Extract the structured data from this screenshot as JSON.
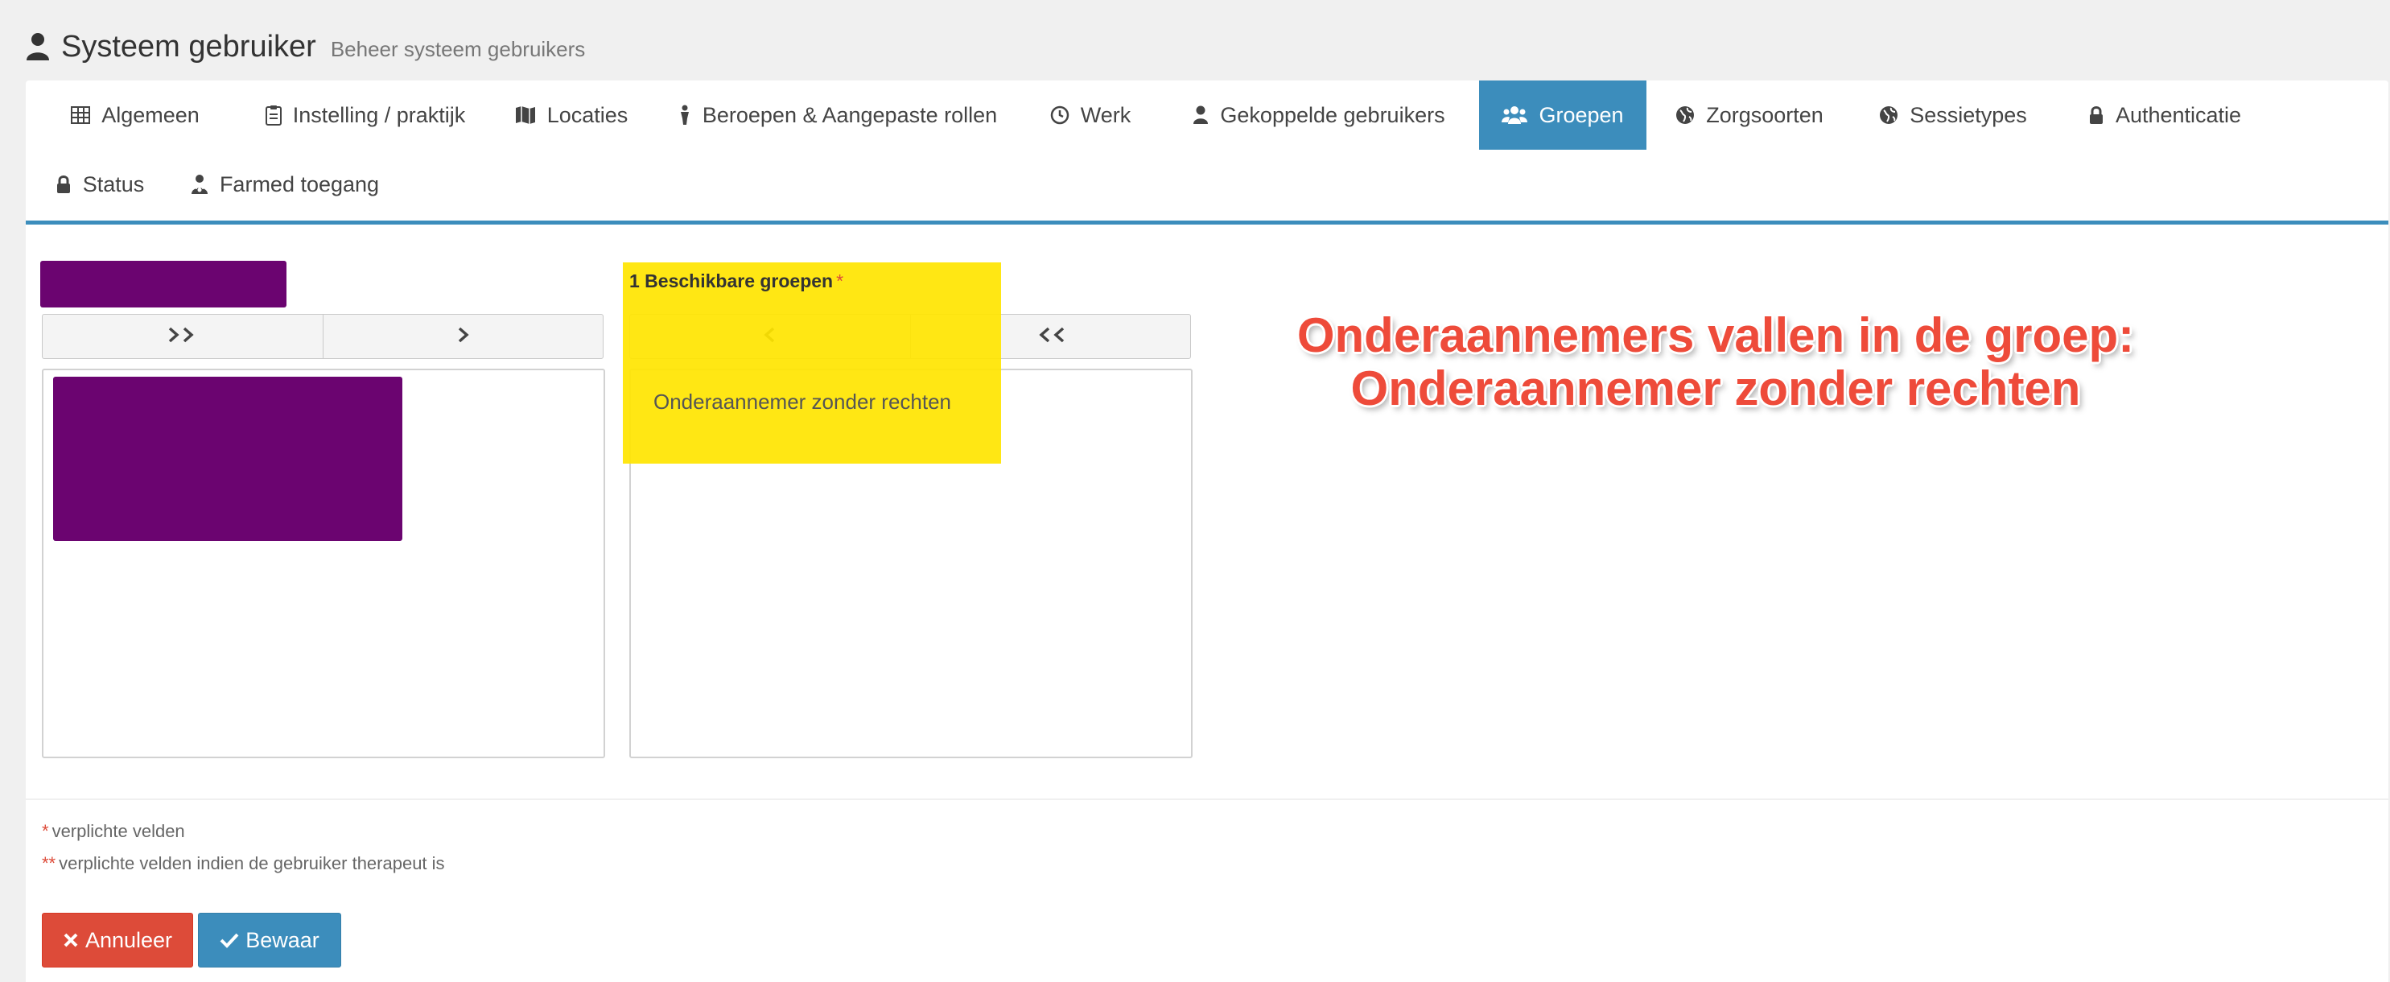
{
  "header": {
    "title": "Systeem gebruiker",
    "subtitle": "Beheer systeem gebruikers",
    "icon": "user-icon"
  },
  "tabs": [
    {
      "label": "Algemeen",
      "icon": "table-icon"
    },
    {
      "label": "Instelling / praktijk",
      "icon": "clipboard-icon"
    },
    {
      "label": "Locaties",
      "icon": "map-icon"
    },
    {
      "label": "Beroepen & Aangepaste rollen",
      "icon": "person-icon"
    },
    {
      "label": "Werk",
      "icon": "clock-icon"
    },
    {
      "label": "Gekoppelde gebruikers",
      "icon": "user-icon"
    },
    {
      "label": "Groepen",
      "icon": "users-icon",
      "active": true
    },
    {
      "label": "Zorgsoorten",
      "icon": "globe-icon"
    },
    {
      "label": "Sessietypes",
      "icon": "globe-icon"
    },
    {
      "label": "Authenticatie",
      "icon": "lock-icon"
    },
    {
      "label": "Status",
      "icon": "lock-icon"
    },
    {
      "label": "Farmed toegang",
      "icon": "user-md-icon"
    }
  ],
  "available_groups": {
    "label": "1 Beschikbare groepen",
    "required_mark": "*",
    "options": [
      "Onderaannemer zonder rechten"
    ]
  },
  "annotation": {
    "line1": "Onderaannemers vallen in de groep:",
    "line2": "Onderaannemer zonder rechten"
  },
  "notes": {
    "required_mark": "*",
    "required_text": "verplichte velden",
    "therapist_mark": "**",
    "therapist_text": "verplichte velden indien de gebruiker therapeut is"
  },
  "actions": {
    "cancel_label": "Annuleer",
    "save_label": "Bewaar"
  },
  "colors": {
    "primary": "#3c8dbc",
    "danger": "#dd4b39",
    "redacted": "#6b0470",
    "highlight": "#ffe500",
    "annotation": "#ee4b3a"
  }
}
